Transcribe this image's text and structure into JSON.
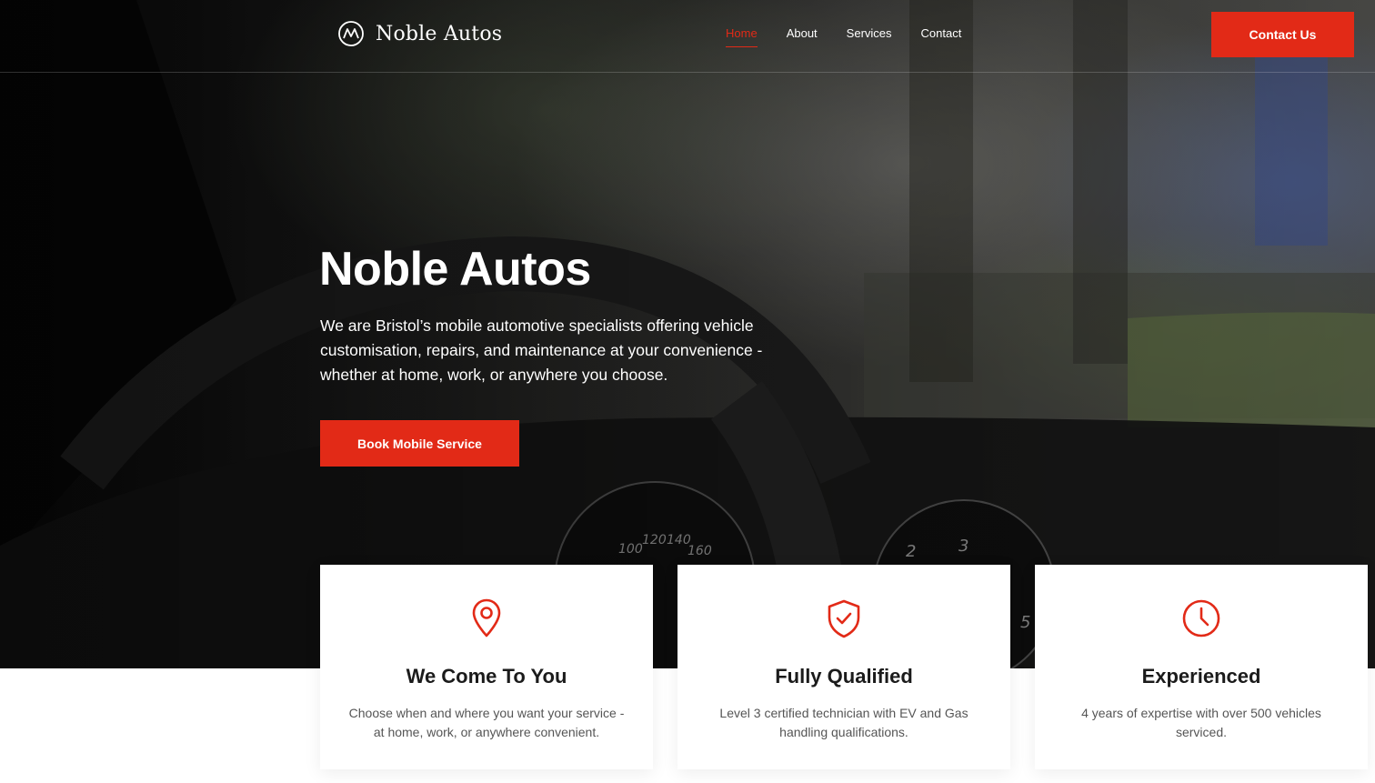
{
  "header": {
    "logo_text": "Noble Autos",
    "nav": [
      {
        "label": "Home",
        "active": true
      },
      {
        "label": "About",
        "active": false
      },
      {
        "label": "Services",
        "active": false
      },
      {
        "label": "Contact",
        "active": false
      }
    ],
    "cta_label": "Contact Us"
  },
  "hero": {
    "title": "Noble Autos",
    "description": "We are Bristol’s mobile automotive specialists offering vehicle customisation, repairs, and maintenance at your convenience - whether at home, work, or anywhere you choose.",
    "button_label": "Book Mobile Service"
  },
  "features": [
    {
      "icon": "location-pin-icon",
      "title": "We Come To You",
      "text": "Choose when and where you want your service - at home, work, or anywhere convenient."
    },
    {
      "icon": "shield-check-icon",
      "title": "Fully Qualified",
      "text": "Level 3 certified technician with EV and Gas handling qualifications."
    },
    {
      "icon": "clock-icon",
      "title": "Experienced",
      "text": "4 years of expertise with over 500 vehicles serviced."
    }
  ],
  "gauge_labels": [
    "100",
    "120",
    "140",
    "160",
    "2",
    "3",
    "5"
  ],
  "colors": {
    "accent": "#e22a17",
    "heading": "#1b1b1b",
    "body_text": "#555555"
  }
}
